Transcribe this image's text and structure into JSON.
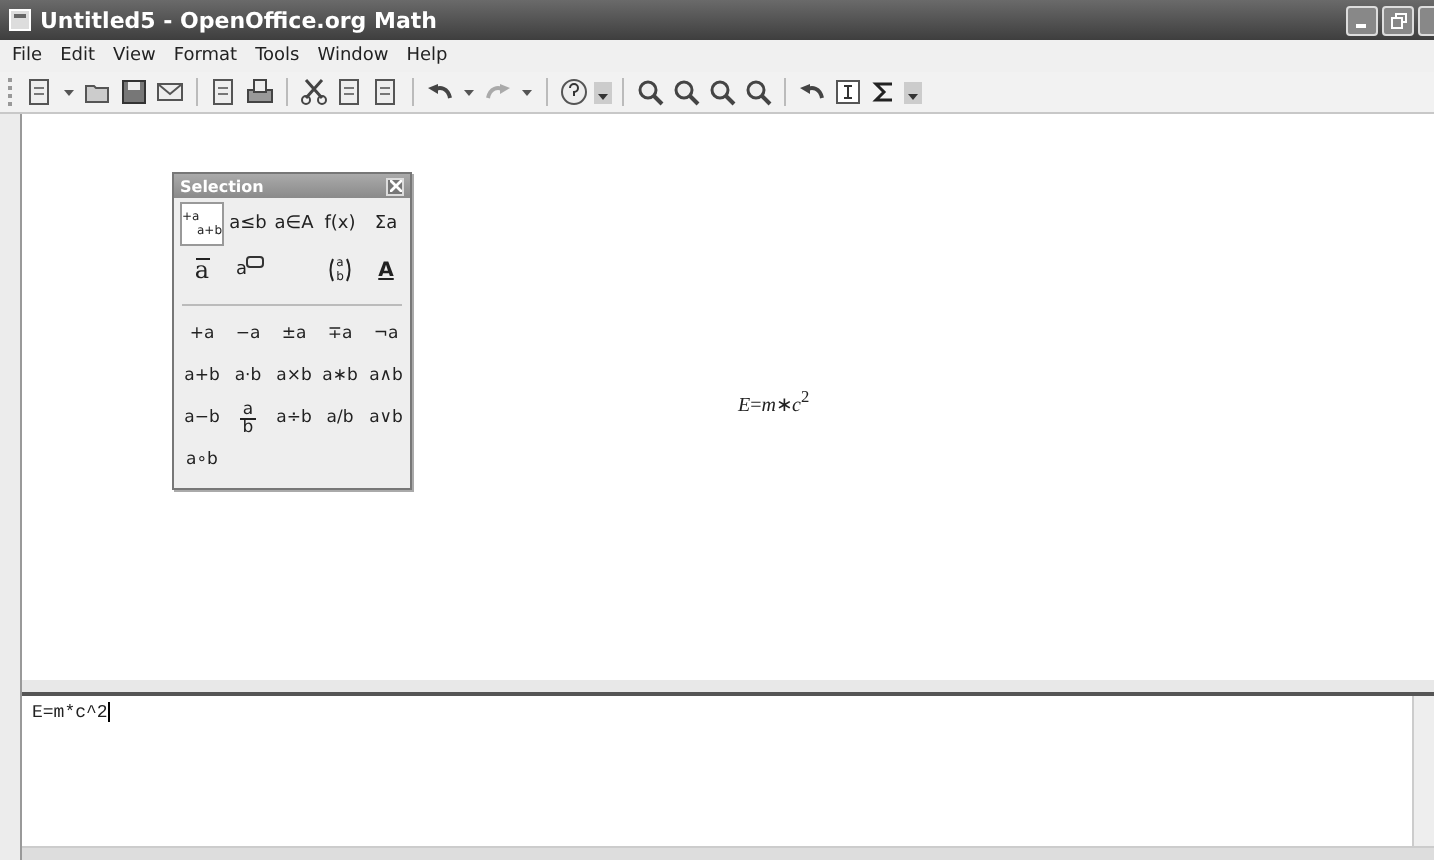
{
  "window": {
    "title": "Untitled5 - OpenOffice.org Math"
  },
  "menu": [
    "File",
    "Edit",
    "View",
    "Format",
    "Tools",
    "Window",
    "Help"
  ],
  "toolbar": [
    {
      "kind": "new",
      "dropdown": true
    },
    {
      "kind": "open"
    },
    {
      "kind": "save"
    },
    {
      "kind": "mail"
    },
    {
      "kind": "sep"
    },
    {
      "kind": "pdf"
    },
    {
      "kind": "print"
    },
    {
      "kind": "sep"
    },
    {
      "kind": "cut"
    },
    {
      "kind": "copy"
    },
    {
      "kind": "paste"
    },
    {
      "kind": "sep"
    },
    {
      "kind": "undo",
      "dropdown": true
    },
    {
      "kind": "redo",
      "dropdown": true
    },
    {
      "kind": "sep"
    },
    {
      "kind": "help"
    },
    {
      "kind": "more"
    },
    {
      "kind": "sep"
    },
    {
      "kind": "zoom-in"
    },
    {
      "kind": "zoom-out"
    },
    {
      "kind": "zoom-all"
    },
    {
      "kind": "zoom"
    },
    {
      "kind": "sep"
    },
    {
      "kind": "update"
    },
    {
      "kind": "cursor"
    },
    {
      "kind": "sigma"
    },
    {
      "kind": "more"
    }
  ],
  "selection_panel": {
    "title": "Selection",
    "categories": [
      {
        "kind": "split",
        "top": "+a",
        "bottom": "a+b",
        "selected": true
      },
      {
        "kind": "text",
        "label": "a≤b",
        "selected": false
      },
      {
        "kind": "text",
        "label": "a∈A",
        "selected": false
      },
      {
        "kind": "text",
        "label": "f(x)",
        "selected": false
      },
      {
        "kind": "text",
        "label": "Σa",
        "selected": false
      },
      {
        "kind": "vector",
        "label": "a",
        "selected": false
      },
      {
        "kind": "bubble",
        "label": "a",
        "selected": false
      },
      {
        "kind": "blank"
      },
      {
        "kind": "matrix",
        "top": "a",
        "bottom": "b",
        "selected": false
      },
      {
        "kind": "format",
        "label": "A",
        "selected": false
      }
    ],
    "symbols": [
      {
        "kind": "text",
        "label": "+a"
      },
      {
        "kind": "text",
        "label": "−a"
      },
      {
        "kind": "text",
        "label": "±a"
      },
      {
        "kind": "text",
        "label": "∓a"
      },
      {
        "kind": "text",
        "label": "¬a"
      },
      {
        "kind": "text",
        "label": "a+b"
      },
      {
        "kind": "text",
        "label": "a·b"
      },
      {
        "kind": "text",
        "label": "a×b"
      },
      {
        "kind": "text",
        "label": "a∗b"
      },
      {
        "kind": "text",
        "label": "a∧b"
      },
      {
        "kind": "text",
        "label": "a−b"
      },
      {
        "kind": "fraction",
        "top": "a",
        "bottom": "b"
      },
      {
        "kind": "text",
        "label": "a÷b"
      },
      {
        "kind": "text",
        "label": "a/b"
      },
      {
        "kind": "text",
        "label": "a∨b"
      },
      {
        "kind": "text",
        "label": "a∘b"
      }
    ]
  },
  "formula": "*E*=*m*∗*c*$^{2}$",
  "command": "E=m*c^2"
}
